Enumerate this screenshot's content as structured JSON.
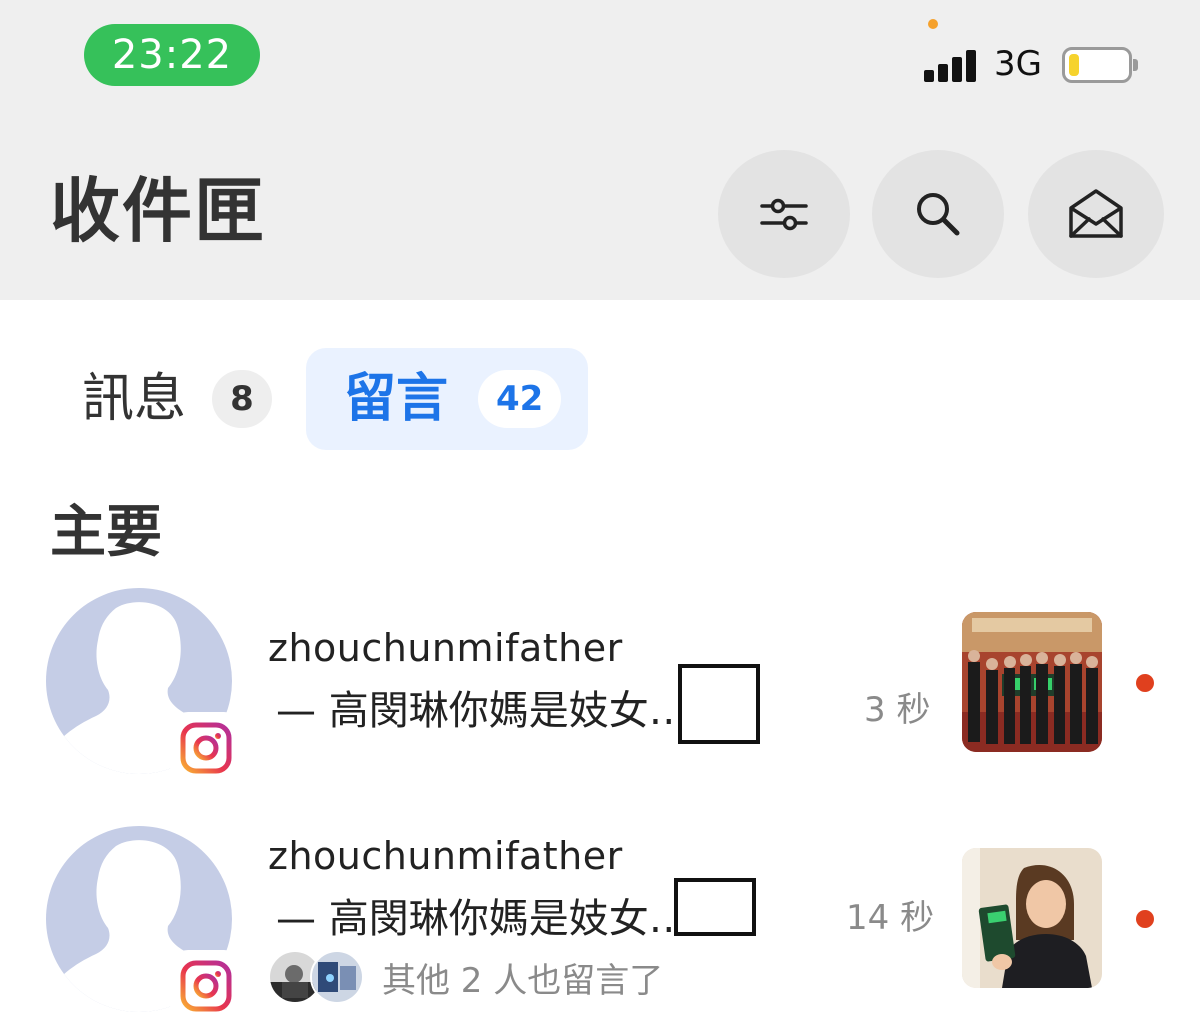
{
  "status_bar": {
    "time": "23:22",
    "network": "3G",
    "battery_level_percent": 18
  },
  "header": {
    "title": "收件匣",
    "buttons": [
      {
        "icon": "filter-sliders-icon"
      },
      {
        "icon": "search-icon"
      },
      {
        "icon": "open-envelope-icon"
      }
    ]
  },
  "tabs": [
    {
      "label": "訊息",
      "count": "8",
      "active": false
    },
    {
      "label": "留言",
      "count": "42",
      "active": true
    }
  ],
  "section": {
    "title": "主要"
  },
  "comments": [
    {
      "username": "zhouchunmifather",
      "text": "— 高閔琳你媽是妓女",
      "ellipsis": "…",
      "time": "3 秒",
      "unread": true,
      "platform": "instagram"
    },
    {
      "username": "zhouchunmifather",
      "text": "— 高閔琳你媽是妓女",
      "ellipsis": "…",
      "time": "14 秒",
      "unread": true,
      "platform": "instagram",
      "others_text": "其他 2 人也留言了"
    }
  ],
  "colors": {
    "time_pill": "#36c15a",
    "accent_blue": "#1d74e8",
    "unread_dot": "#e0401e",
    "header_bg": "#efefef"
  }
}
